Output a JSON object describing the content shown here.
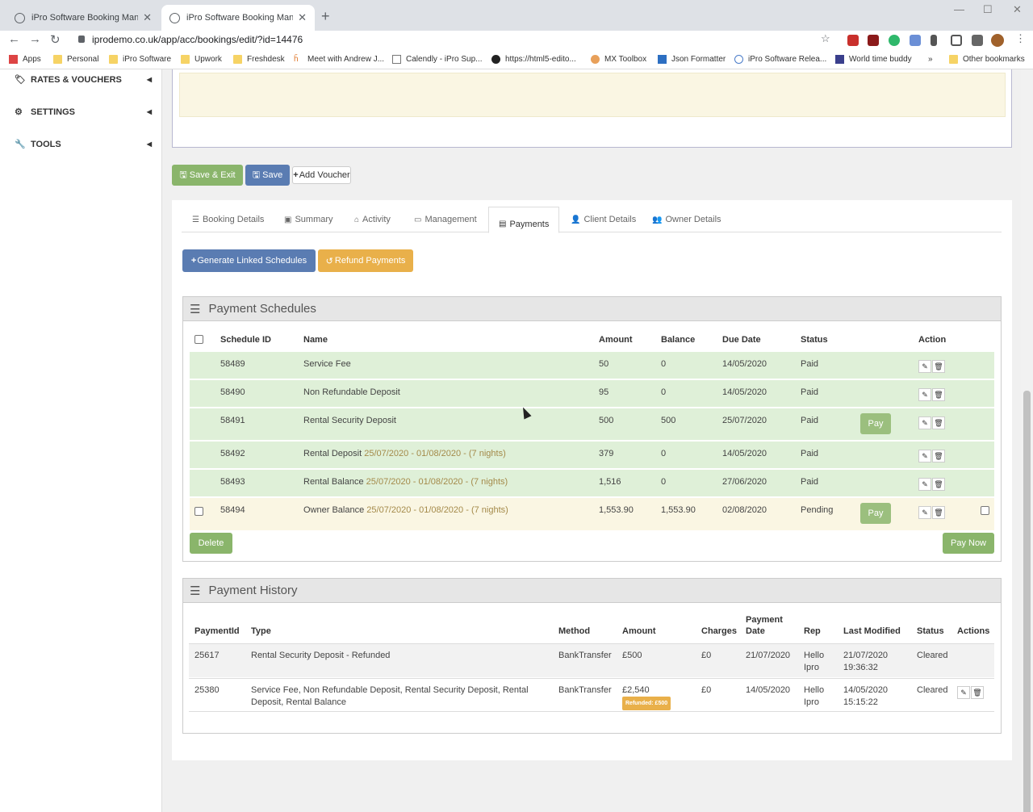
{
  "browser": {
    "tabs": [
      {
        "title": "iPro Software Booking Managem"
      },
      {
        "title": "iPro Software Booking Managem"
      }
    ],
    "url": "iprodemo.co.uk/app/acc/bookings/edit/?id=14476",
    "bookmarks": [
      "Apps",
      "Personal",
      "iPro Software",
      "Upwork",
      "Freshdesk",
      "Meet with Andrew J...",
      "Calendly - iPro Sup...",
      "https://html5-edito...",
      "MX Toolbox",
      "Json Formatter",
      "iPro Software Relea...",
      "World time buddy",
      "»",
      "Other bookmarks"
    ]
  },
  "sidebar": {
    "items": [
      {
        "label": "RATES & VOUCHERS",
        "icon": "tag-icon"
      },
      {
        "label": "SETTINGS",
        "icon": "gear-icon"
      },
      {
        "label": "TOOLS",
        "icon": "wrench-icon"
      }
    ]
  },
  "actions": {
    "save_exit": "Save & Exit",
    "save": "Save",
    "add_voucher": "Add Voucher"
  },
  "tabs": [
    "Booking Details",
    "Summary",
    "Activity",
    "Management",
    "Payments",
    "Client Details",
    "Owner Details"
  ],
  "payments": {
    "generate": "Generate Linked Schedules",
    "refund": "Refund Payments"
  },
  "schedules": {
    "title": "Payment Schedules",
    "headers": [
      "Schedule ID",
      "Name",
      "Amount",
      "Balance",
      "Due Date",
      "Status",
      "Action"
    ],
    "rows": [
      {
        "id": "58489",
        "name": "Service Fee",
        "dates": "",
        "amount": "50",
        "balance": "0",
        "due": "14/05/2020",
        "status": "Paid",
        "pay": ""
      },
      {
        "id": "58490",
        "name": "Non Refundable Deposit",
        "dates": "",
        "amount": "95",
        "balance": "0",
        "due": "14/05/2020",
        "status": "Paid",
        "pay": ""
      },
      {
        "id": "58491",
        "name": "Rental Security Deposit",
        "dates": "",
        "amount": "500",
        "balance": "500",
        "due": "25/07/2020",
        "status": "Paid",
        "pay": "Pay"
      },
      {
        "id": "58492",
        "name": "Rental Deposit",
        "dates": "25/07/2020 - 01/08/2020 - (7 nights)",
        "amount": "379",
        "balance": "0",
        "due": "14/05/2020",
        "status": "Paid",
        "pay": ""
      },
      {
        "id": "58493",
        "name": "Rental Balance",
        "dates": "25/07/2020 - 01/08/2020 - (7 nights)",
        "amount": "1,516",
        "balance": "0",
        "due": "27/06/2020",
        "status": "Paid",
        "pay": ""
      },
      {
        "id": "58494",
        "name": "Owner Balance",
        "dates": "25/07/2020 - 01/08/2020 - (7 nights)",
        "amount": "1,553.90",
        "balance": "1,553.90",
        "due": "02/08/2020",
        "status": "Pending",
        "pay": "Pay"
      }
    ],
    "delete": "Delete",
    "pay_now": "Pay Now"
  },
  "history": {
    "title": "Payment History",
    "headers": {
      "paymentid": "PaymentId",
      "type": "Type",
      "method": "Method",
      "amount": "Amount",
      "charges": "Charges",
      "date_l1": "Payment",
      "date_l2": "Date",
      "rep": "Rep",
      "modified": "Last Modified",
      "status": "Status",
      "actions": "Actions"
    },
    "rows": [
      {
        "id": "25617",
        "type": "Rental Security Deposit - Refunded",
        "method": "BankTransfer",
        "amount": "£500",
        "badge": "",
        "charges": "£0",
        "date": "21/07/2020",
        "rep_l1": "Hello",
        "rep_l2": "Ipro",
        "mod_l1": "21/07/2020",
        "mod_l2": "19:36:32",
        "status": "Cleared"
      },
      {
        "id": "25380",
        "type": "Service Fee, Non Refundable Deposit, Rental Security Deposit, Rental Deposit, Rental Balance",
        "method": "BankTransfer",
        "amount": "£2,540",
        "badge": "Refunded: £500",
        "charges": "£0",
        "date": "14/05/2020",
        "rep_l1": "Hello",
        "rep_l2": "Ipro",
        "mod_l1": "14/05/2020",
        "mod_l2": "15:15:22",
        "status": "Cleared"
      }
    ]
  }
}
